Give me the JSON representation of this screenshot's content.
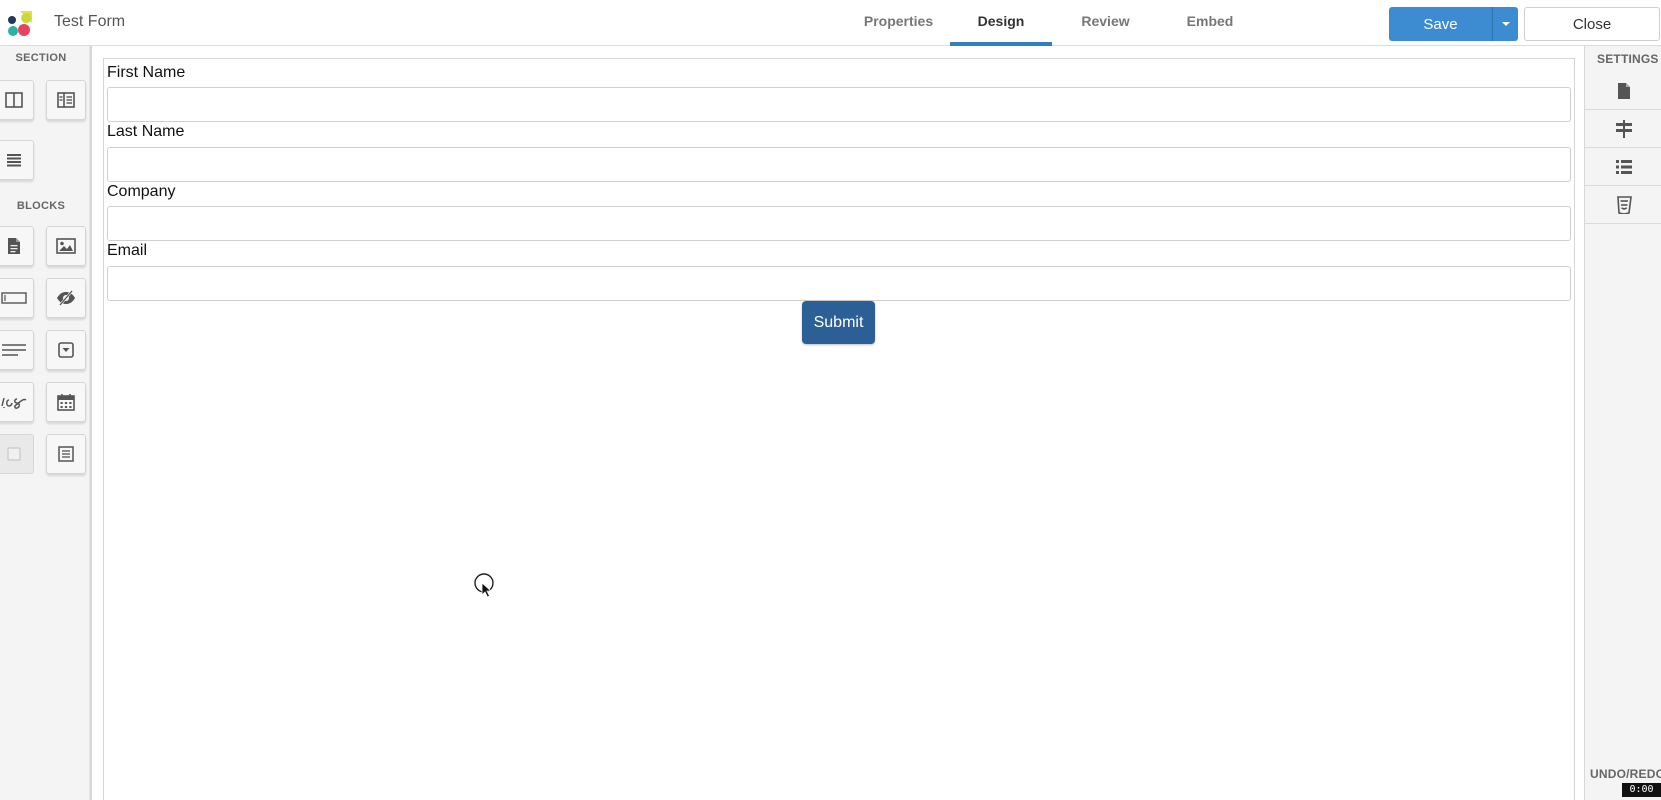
{
  "header": {
    "app_title": "Test Form",
    "tabs": [
      {
        "label": "Properties",
        "active": false
      },
      {
        "label": "Design",
        "active": true
      },
      {
        "label": "Review",
        "active": false
      },
      {
        "label": "Embed",
        "active": false
      }
    ],
    "save_label": "Save",
    "close_label": "Close"
  },
  "left_sidebar": {
    "section_heading": "SECTION",
    "section_tools": [
      "two-column-layout-icon",
      "sidebar-layout-icon",
      "single-column-icon"
    ],
    "blocks_heading": "BLOCKS",
    "block_tools": [
      "document-icon",
      "image-icon",
      "text-input-icon",
      "eye-slash-icon",
      "paragraph-icon",
      "dropdown-icon",
      "signature-icon",
      "calendar-icon",
      "checkbox-icon",
      "form-list-icon"
    ]
  },
  "form": {
    "fields": [
      {
        "label": "First Name",
        "value": ""
      },
      {
        "label": "Last Name",
        "value": ""
      },
      {
        "label": "Company",
        "value": ""
      },
      {
        "label": "Email",
        "value": ""
      }
    ],
    "submit_label": "Submit"
  },
  "right_sidebar": {
    "settings_heading": "SETTINGS",
    "setting_tools": [
      "file-icon",
      "signpost-icon",
      "list-icon",
      "css-icon"
    ],
    "undo_heading": "UNDO/REDO"
  },
  "overlay": {
    "timecode": "0:00"
  },
  "colors": {
    "accent": "#3d8bd0",
    "submit": "#2c5f96",
    "active_tab_underline": "#2f7fc3"
  }
}
